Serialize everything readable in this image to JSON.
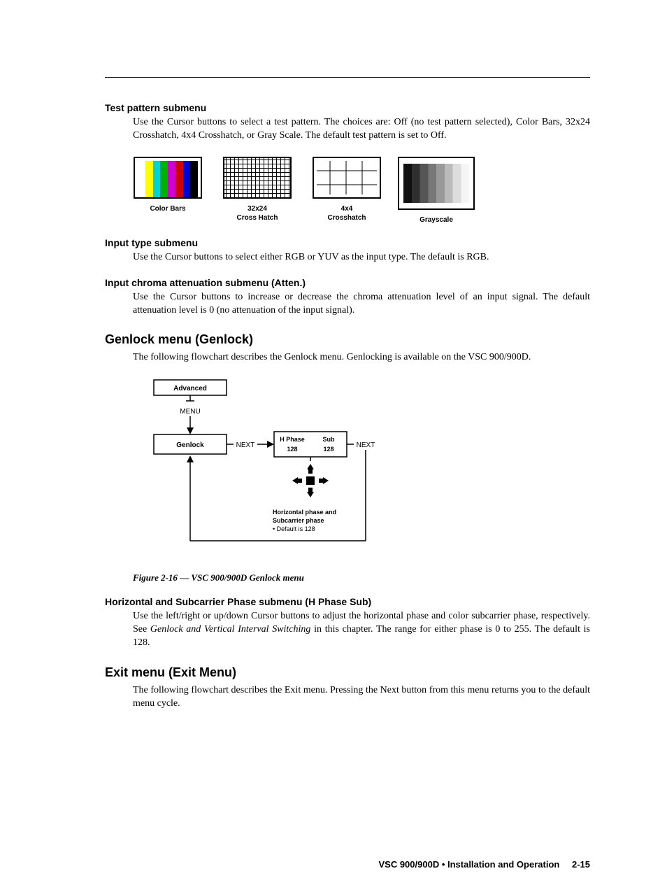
{
  "sections": {
    "test_pattern": {
      "heading": "Test pattern submenu",
      "body": "Use the Cursor buttons to select a test pattern.  The choices are: Off (no test pattern selected), Color Bars, 32x24 Crosshatch, 4x4 Crosshatch, or Gray Scale.  The default test pattern is set to Off.",
      "patterns": [
        {
          "label": "Color Bars"
        },
        {
          "label": "32x24\nCross Hatch"
        },
        {
          "label": "4x4\nCrosshatch"
        },
        {
          "label": "Grayscale"
        }
      ]
    },
    "input_type": {
      "heading": "Input type submenu",
      "body": "Use the Cursor buttons to select either RGB or YUV as the input type.  The default is RGB."
    },
    "input_chroma": {
      "heading": "Input chroma attenuation submenu (Atten.)",
      "body": "Use the Cursor buttons to increase or decrease the chroma attenuation level of an input signal.  The default attenuation level is 0 (no attenuation of the input signal)."
    },
    "genlock": {
      "heading": "Genlock menu (Genlock)",
      "body": "The following flowchart describes the Genlock menu.  Genlocking is available on the VSC 900/900D.",
      "flowchart": {
        "box_advanced": "Advanced",
        "label_menu": "MENU",
        "box_genlock": "Genlock",
        "label_next1": "NEXT",
        "box_hphase_line1": "H Phase",
        "box_hphase_line2": "Sub",
        "box_hphase_val1": "128",
        "box_hphase_val2": "128",
        "label_next2": "NEXT",
        "note_line1": "Horizontal phase and",
        "note_line2": "Subcarrier phase",
        "note_line3": "• Default is 128"
      },
      "caption": "Figure 2-16 — VSC 900/900D Genlock menu"
    },
    "h_phase": {
      "heading": "Horizontal and Subcarrier Phase submenu (H Phase Sub)",
      "body_pre": "Use the left/right or up/down Cursor buttons to adjust the horizontal phase and color subcarrier phase, respectively.  See ",
      "body_italic": "Genlock and Vertical Interval Switching",
      "body_post": " in this chapter.  The range for either phase is 0 to 255.  The default is 128."
    },
    "exit": {
      "heading": "Exit menu (Exit Menu)",
      "body": "The following flowchart describes the Exit menu.  Pressing the Next button from this menu returns you to the default menu cycle."
    }
  },
  "footer": {
    "doc": "VSC 900/900D • Installation and Operation",
    "page": "2-15"
  }
}
